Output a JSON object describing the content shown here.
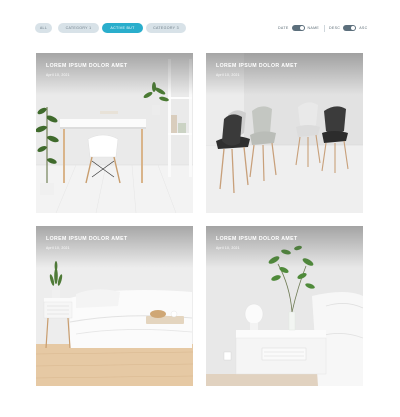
{
  "filters": [
    {
      "label": "ALL",
      "active": false
    },
    {
      "label": "CATEGORY 1",
      "active": false
    },
    {
      "label": "ACTIVE BUT",
      "active": true
    },
    {
      "label": "CATEGORY 3",
      "active": false
    }
  ],
  "sort": {
    "left_label": "DATE",
    "right_label": "NAME",
    "order_left_label": "DESC",
    "order_right_label": "ASC"
  },
  "cards": [
    {
      "title": "LOREM IPSUM DOLOR AMET",
      "date": "April 10, 2021",
      "scene": "white desk with chair and plants"
    },
    {
      "title": "LOREM IPSUM DOLOR AMET",
      "date": "April 10, 2021",
      "scene": "four shell chairs in a white room"
    },
    {
      "title": "LOREM IPSUM DOLOR AMET",
      "date": "April 10, 2021",
      "scene": "white bedroom with nightstand and tray"
    },
    {
      "title": "LOREM IPSUM DOLOR AMET",
      "date": "April 10, 2021",
      "scene": "nightstand with lamp and branch in vase"
    }
  ]
}
